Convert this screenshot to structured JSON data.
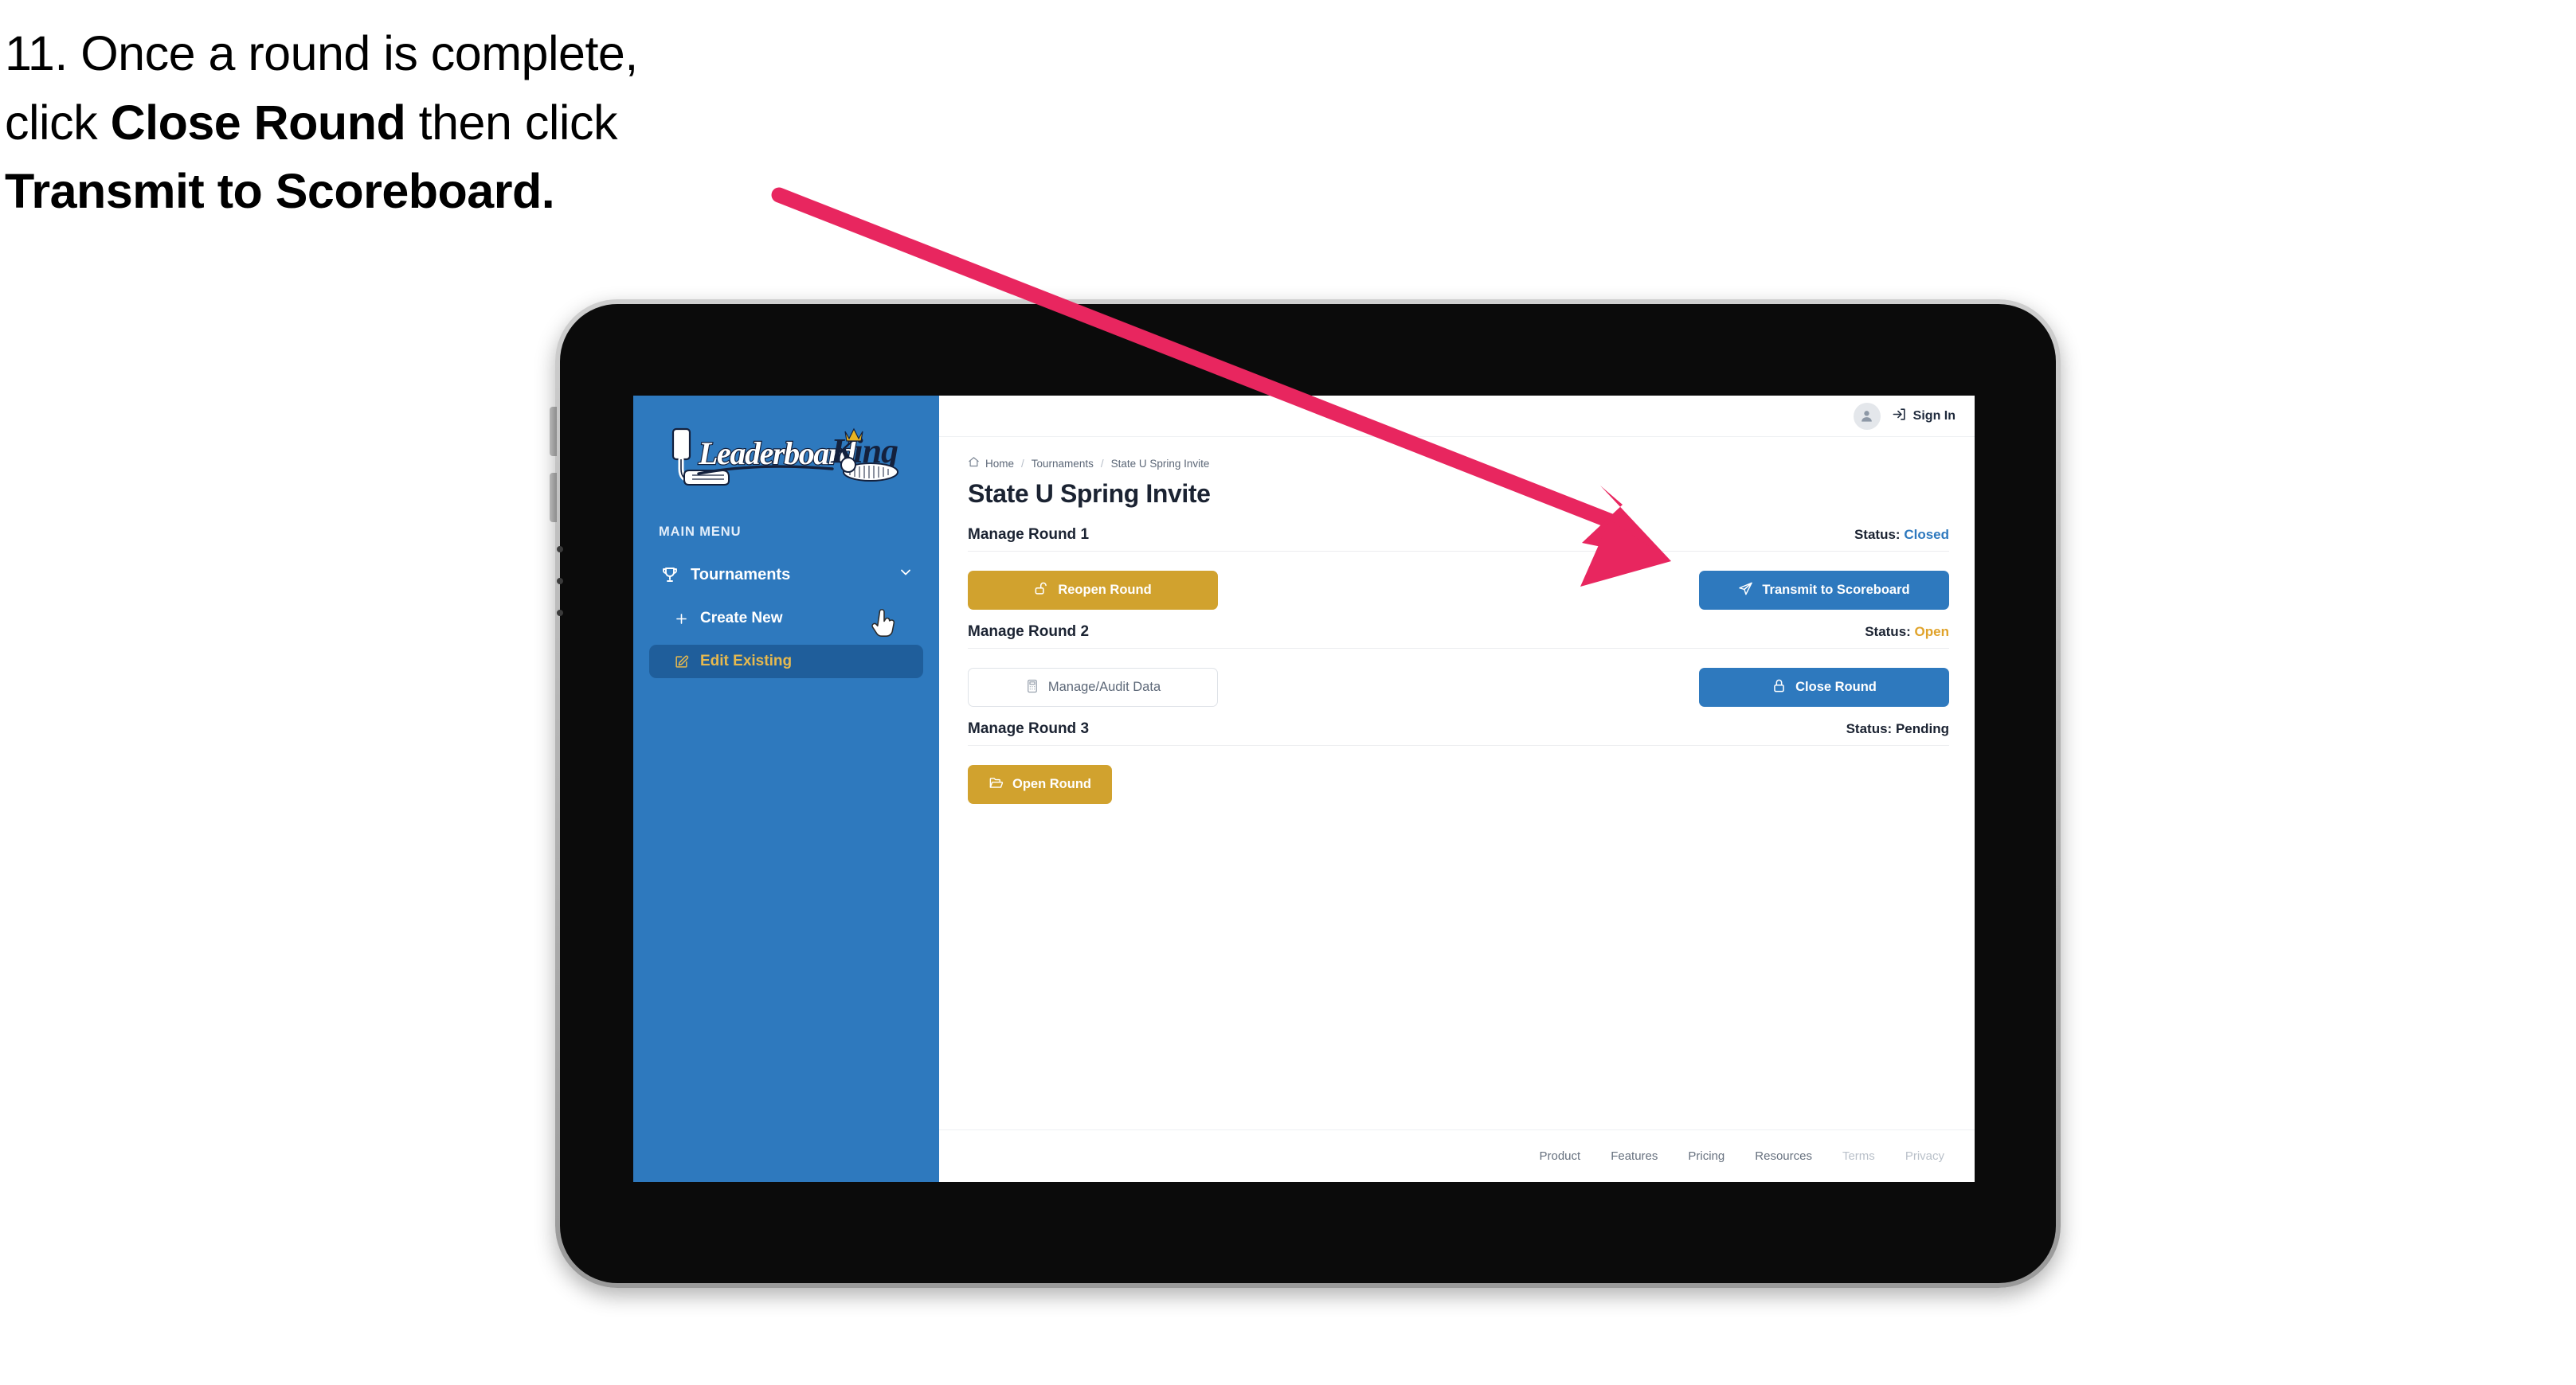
{
  "caption": {
    "number": "11.",
    "line1_pre": "11. Once a round is complete,",
    "line2_pre": "click ",
    "line2_bold": "Close Round",
    "line2_post": " then click",
    "line3_bold": "Transmit to Scoreboard."
  },
  "annotation": {
    "arrow_color": "#e8265f",
    "arrow_start": "978,245",
    "arrow_tip": "2098,705"
  },
  "app": {
    "logo_text_primary": "Leaderboard",
    "logo_text_secondary": "King"
  },
  "sidebar": {
    "bg_color": "#2e79be",
    "menu_label": "MAIN MENU",
    "items": [
      {
        "label": "Tournaments",
        "icon": "trophy-icon",
        "chevron": "chevron-down-icon"
      }
    ],
    "sub_items": [
      {
        "label": "Create New",
        "icon": "plus-icon",
        "active": false
      },
      {
        "label": "Edit Existing",
        "icon": "edit-pencil-icon",
        "active": true
      }
    ],
    "active_color": "#e6b94f",
    "active_bg": "#1f5e9b"
  },
  "topbar": {
    "avatar_icon": "user-avatar-icon",
    "signin_icon": "sign-in-arrow-icon",
    "signin_label": "Sign In"
  },
  "breadcrumb": {
    "home_icon": "home-icon",
    "items": [
      "Home",
      "Tournaments",
      "State U Spring Invite"
    ],
    "separator": "/"
  },
  "page": {
    "title": "State U Spring Invite"
  },
  "rounds": [
    {
      "name": "Manage Round 1",
      "status_label": "Status:",
      "status_value": "Closed",
      "status_color": "#2e79be",
      "left_button": {
        "label": "Reopen Round",
        "icon": "unlock-icon",
        "style": "gold"
      },
      "right_button": {
        "label": "Transmit to Scoreboard",
        "icon": "paper-plane-icon",
        "style": "blue"
      }
    },
    {
      "name": "Manage Round 2",
      "status_label": "Status:",
      "status_value": "Open",
      "status_color": "#e0a32b",
      "left_button": {
        "label": "Manage/Audit Data",
        "icon": "calculator-icon",
        "style": "outline"
      },
      "right_button": {
        "label": "Close Round",
        "icon": "lock-icon",
        "style": "blue"
      }
    },
    {
      "name": "Manage Round 3",
      "status_label": "Status:",
      "status_value": "Pending",
      "status_color": "#1b2332",
      "left_button": {
        "label": "Open Round",
        "icon": "open-folder-icon",
        "style": "gold-sm"
      },
      "right_button": null
    }
  ],
  "footer": {
    "links": [
      {
        "label": "Product",
        "muted": false
      },
      {
        "label": "Features",
        "muted": false
      },
      {
        "label": "Pricing",
        "muted": false
      },
      {
        "label": "Resources",
        "muted": false
      },
      {
        "label": "Terms",
        "muted": true
      },
      {
        "label": "Privacy",
        "muted": true
      }
    ]
  }
}
